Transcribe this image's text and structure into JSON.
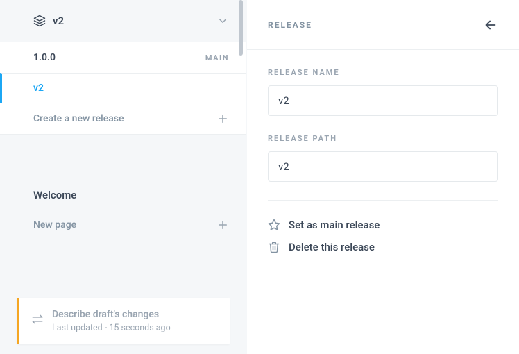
{
  "sidebar": {
    "dropdown": {
      "label": "v2"
    },
    "releases": [
      {
        "name": "1.0.0",
        "main_tag": "MAIN"
      },
      {
        "name": "v2"
      }
    ],
    "create_release_label": "Create a new release",
    "pages_heading": "Welcome",
    "new_page_label": "New page",
    "draft": {
      "title": "Describe draft's changes",
      "subtitle": "Last updated - 15 seconds ago"
    }
  },
  "panel": {
    "header_title": "RELEASE",
    "fields": {
      "name_label": "RELEASE NAME",
      "name_value": "v2",
      "path_label": "RELEASE PATH",
      "path_value": "v2"
    },
    "actions": {
      "set_main": "Set as main release",
      "delete": "Delete this release"
    }
  }
}
